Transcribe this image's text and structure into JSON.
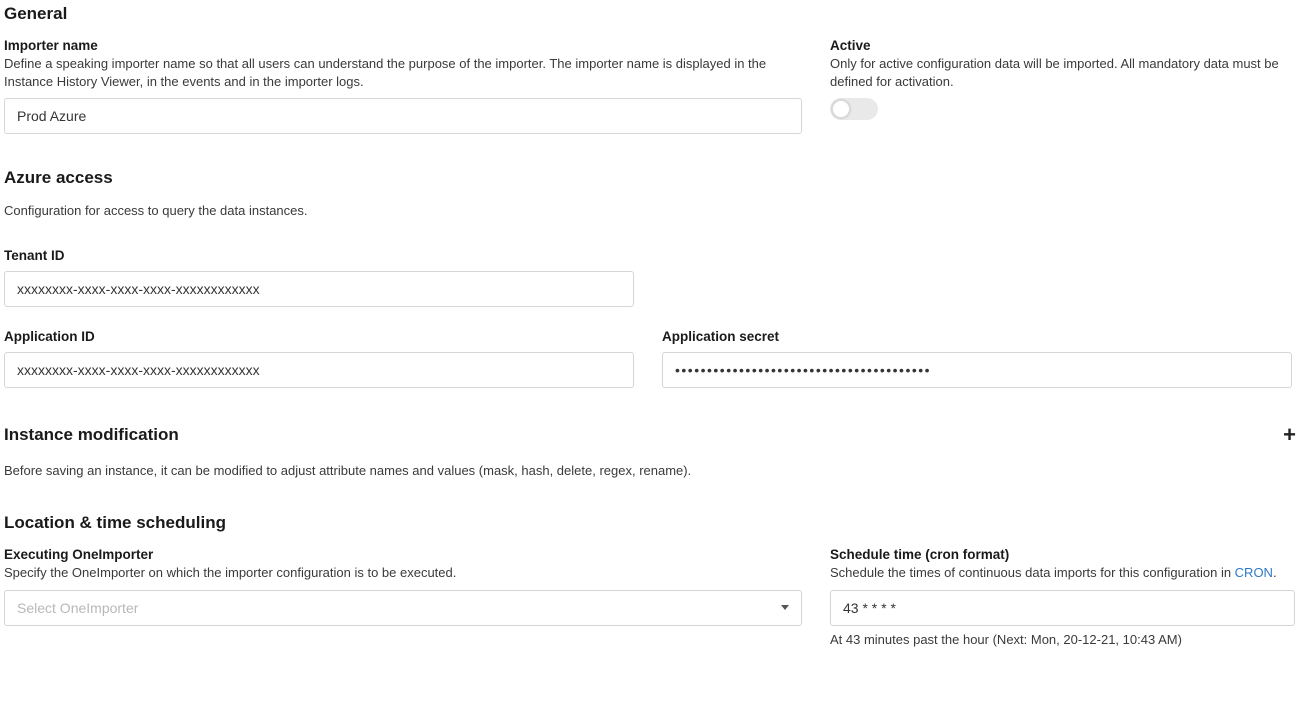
{
  "general": {
    "title": "General",
    "importer_name": {
      "label": "Importer name",
      "desc": "Define a speaking importer name so that all users can understand the purpose of the importer. The importer name is displayed in the Instance History Viewer, in the events and in the importer logs.",
      "value": "Prod Azure"
    },
    "active": {
      "label": "Active",
      "desc": "Only for active configuration data will be imported. All mandatory data must be defined for activation."
    }
  },
  "azure": {
    "title": "Azure access",
    "desc": "Configuration for access to query the data instances.",
    "tenant_id": {
      "label": "Tenant ID",
      "value": "xxxxxxxx-xxxx-xxxx-xxxx-xxxxxxxxxxxx"
    },
    "application_id": {
      "label": "Application ID",
      "value": "xxxxxxxx-xxxx-xxxx-xxxx-xxxxxxxxxxxx"
    },
    "application_secret": {
      "label": "Application secret",
      "value": "••••••••••••••••••••••••••••••••••••••••"
    }
  },
  "instance_mod": {
    "title": "Instance modification",
    "desc": "Before saving an instance, it can be modified to adjust attribute names and values (mask, hash, delete, regex, rename)."
  },
  "location": {
    "title": "Location & time scheduling",
    "executor": {
      "label": "Executing OneImporter",
      "desc": "Specify the OneImporter on which the importer configuration is to be executed.",
      "placeholder": "Select OneImporter"
    },
    "schedule": {
      "label": "Schedule time (cron format)",
      "desc_prefix": "Schedule the times of continuous data imports for this configuration in ",
      "desc_link": "CRON",
      "desc_suffix": ".",
      "value": "43 * * * *",
      "hint": "At 43 minutes past the hour (Next: Mon, 20-12-21, 10:43 AM)"
    }
  }
}
